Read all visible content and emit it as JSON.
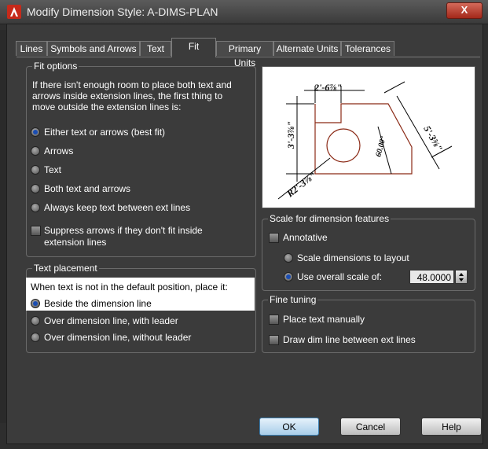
{
  "window": {
    "title": "Modify Dimension Style: A-DIMS-PLAN",
    "close_label": "X"
  },
  "tabs": [
    "Lines",
    "Symbols and Arrows",
    "Text",
    "Fit",
    "Primary Units",
    "Alternate Units",
    "Tolerances"
  ],
  "fit_options": {
    "title": "Fit options",
    "description": [
      "If there isn't enough room to place both text and",
      "arrows inside extension lines, the first thing to",
      "move outside the extension lines is:"
    ],
    "options": [
      "Either text or arrows (best fit)",
      "Arrows",
      "Text",
      "Both text and arrows",
      "Always keep text between ext lines"
    ],
    "selected_index": 0,
    "suppress_label": [
      "Suppress arrows if they don't fit inside",
      "extension lines"
    ]
  },
  "text_placement": {
    "title": "Text placement",
    "prompt": "When text is not in the default position, place it:",
    "options": [
      "Beside the dimension line",
      "Over dimension line, with leader",
      "Over dimension line, without leader"
    ],
    "selected_index": 0
  },
  "preview": {
    "dim_top": "2'-6⅞\"",
    "dim_left": "3'-3⅞\"",
    "dim_right": "5'-3⅜\"",
    "dim_inner": "60.00°",
    "dim_radius": "R2'-3⅞\""
  },
  "scale": {
    "title": "Scale for dimension features",
    "annotative_label": "Annotative",
    "layout_label": "Scale dimensions to layout",
    "overall_label": "Use overall scale of:",
    "overall_value": "48.0000"
  },
  "fine_tuning": {
    "title": "Fine tuning",
    "manual_label": "Place text manually",
    "dimline_label": "Draw dim line between ext lines"
  },
  "buttons": {
    "ok": "OK",
    "cancel": "Cancel",
    "help": "Help"
  },
  "colors": {
    "highlight": "#ffffff",
    "preview_line": "#8b2a16",
    "accent": "#1a4db3"
  }
}
